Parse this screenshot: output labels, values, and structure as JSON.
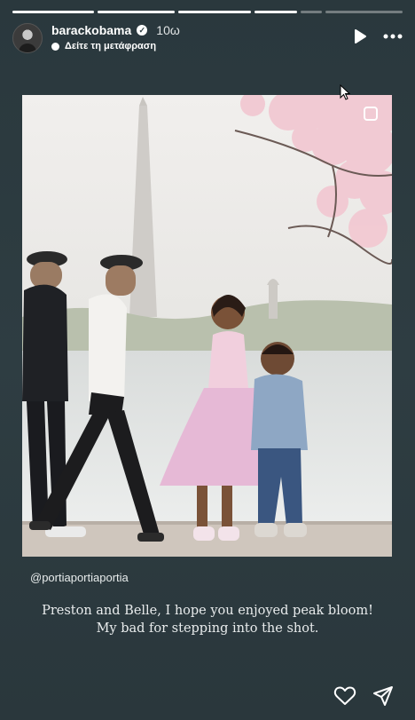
{
  "progress": {
    "segments": [
      1,
      1,
      1,
      1,
      0,
      0
    ]
  },
  "header": {
    "username": "barackobama",
    "verified": true,
    "time_ago": "10ω",
    "translate_label": "Δείτε τη μετάφραση"
  },
  "icons": {
    "play": "play-icon",
    "more": "more-icon",
    "heart": "heart-icon",
    "share": "send-icon",
    "sticker": "square-sticker-icon",
    "cursor": "mouse-cursor-icon"
  },
  "post": {
    "mention": "@portiaportiaportia",
    "caption_line1": "Preston and Belle, I hope you enjoyed peak bloom!",
    "caption_line2": "My bad for stepping into the shot."
  },
  "colors": {
    "background": "#2b3a3f",
    "text": "#ffffff",
    "blossom": "#f2c9d2"
  }
}
